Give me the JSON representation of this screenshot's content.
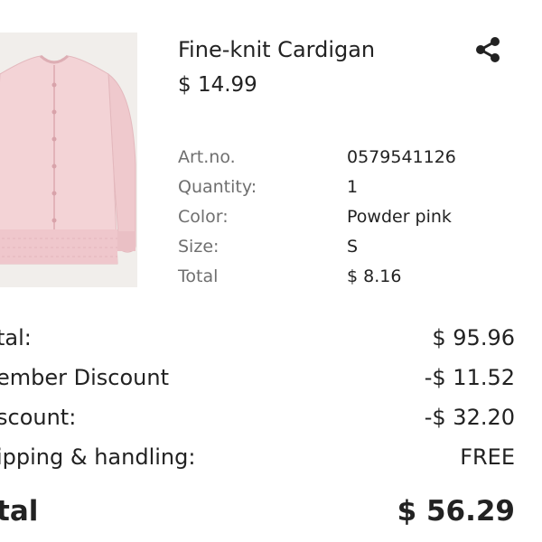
{
  "product": {
    "image_alt": "Powder pink fine-knit cardigan",
    "title": "Fine-knit Cardigan",
    "price": "$ 14.99",
    "share_icon": "share-icon"
  },
  "details": [
    {
      "label": "Art.no.",
      "value": "0579541126"
    },
    {
      "label": "Quantity:",
      "value": "1"
    },
    {
      "label": "Color:",
      "value": "Powder pink"
    },
    {
      "label": "Size:",
      "value": "S"
    },
    {
      "label": "Total",
      "value": "$ 8.16"
    }
  ],
  "summary": [
    {
      "label": "tal:",
      "value": "$ 95.96"
    },
    {
      "label": "ember Discount",
      "value": "-$ 11.52"
    },
    {
      "label": "scount:",
      "value": "-$ 32.20"
    },
    {
      "label": "ipping & handling:",
      "value": "FREE"
    }
  ],
  "total": {
    "label": "tal",
    "value": "$ 56.29"
  },
  "colors": {
    "text": "#222222",
    "muted": "#6f6f6f",
    "image_bg": "#f1eeeb",
    "cardigan": "#f3d3d6"
  }
}
